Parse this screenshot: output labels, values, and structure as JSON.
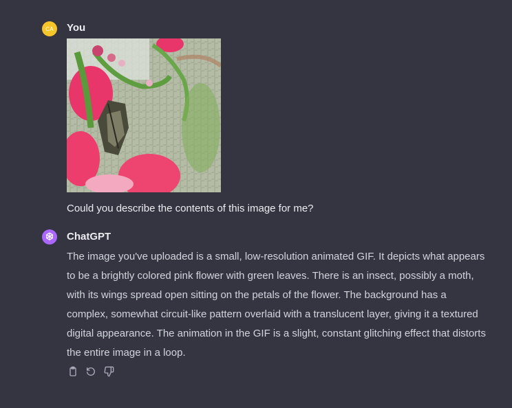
{
  "user_message": {
    "avatar_initials": "CA",
    "author": "You",
    "text": "Could you describe the contents of this image for me?"
  },
  "assistant_message": {
    "avatar_icon": "openai-logo-icon",
    "author": "ChatGPT",
    "text": "The image you've uploaded is a small, low-resolution animated GIF. It depicts what appears to be a brightly colored pink flower with green leaves. There is an insect, possibly a moth, with its wings spread open sitting on the petals of the flower. The background has a complex, somewhat circuit-like pattern overlaid with a translucent layer, giving it a textured digital appearance. The animation in the GIF is a slight, constant glitching effect that distorts the entire image in a loop."
  },
  "actions": [
    {
      "icon": "copy-icon"
    },
    {
      "icon": "regenerate-icon"
    },
    {
      "icon": "thumbs-down-icon"
    }
  ],
  "colors": {
    "background": "#343541",
    "user_avatar": "#f5c52a",
    "assistant_avatar": "#ab68ff",
    "text": "#d1d5db"
  }
}
